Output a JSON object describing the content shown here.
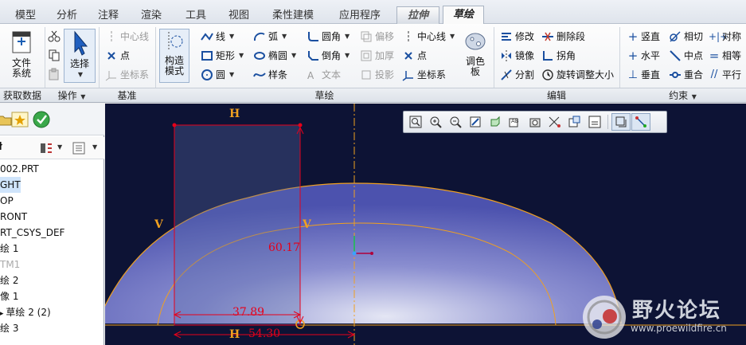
{
  "tabs": [
    "模型",
    "分析",
    "注释",
    "渲染",
    "工具",
    "视图",
    "柔性建模",
    "应用程序",
    "拉伸",
    "草绘"
  ],
  "groups": {
    "get_data": "获取数据",
    "operations": "操作",
    "datum": "基准",
    "sketching": "草绘",
    "editing": "编辑",
    "constrain": "约束"
  },
  "ribbon": {
    "file_system": "文件\n系统",
    "select": "选择",
    "construction_mode": "构造\n模式",
    "palette": "调色\n板",
    "datum_centerline": "中心线",
    "datum_point": "点",
    "datum_csys": "坐标系",
    "line": "线",
    "rectangle": "矩形",
    "circle": "圆",
    "arc": "弧",
    "ellipse": "椭圆",
    "spline": "样条",
    "fillet": "圆角",
    "chamfer": "倒角",
    "text": "文本",
    "offset": "偏移",
    "thicken": "加厚",
    "project": "投影",
    "centerline": "中心线",
    "point": "点",
    "csys": "坐标系",
    "modify": "修改",
    "mirror": "镜像",
    "divide": "分割",
    "delete_segment": "删除段",
    "corner": "拐角",
    "rotate_resize": "旋转调整大小",
    "vertical": "竖直",
    "horizontal": "水平",
    "perpendicular": "垂直",
    "tangent": "相切",
    "midpoint": "中点",
    "coincident": "重合",
    "symmetric": "对称",
    "equal": "相等",
    "parallel": "平行"
  },
  "tree": {
    "items": [
      {
        "label": "002.PRT",
        "state": "normal"
      },
      {
        "label": "GHT",
        "state": "selected"
      },
      {
        "label": "OP",
        "state": "normal"
      },
      {
        "label": "RONT",
        "state": "normal"
      },
      {
        "label": "RT_CSYS_DEF",
        "state": "normal"
      },
      {
        "label": "绘 1",
        "state": "normal"
      },
      {
        "label": "TM1",
        "state": "dim"
      },
      {
        "label": "绘 2",
        "state": "normal"
      },
      {
        "label": "像 1",
        "state": "normal"
      },
      {
        "label": "草绘 2 (2)",
        "state": "normal"
      },
      {
        "label": "绘 3",
        "state": "normal"
      }
    ]
  },
  "sketch": {
    "dim_height": "60.17",
    "dim_width1": "37.89",
    "dim_width2": "54.30",
    "constraint_h": "H",
    "constraint_v": "V"
  },
  "watermark": {
    "title": "野火论坛",
    "url": "www.proewildfire.cn"
  },
  "colors": {
    "canvas_bg": "#0d1335",
    "sketch_line": "#f0a020",
    "dimension": "#e6001a"
  }
}
